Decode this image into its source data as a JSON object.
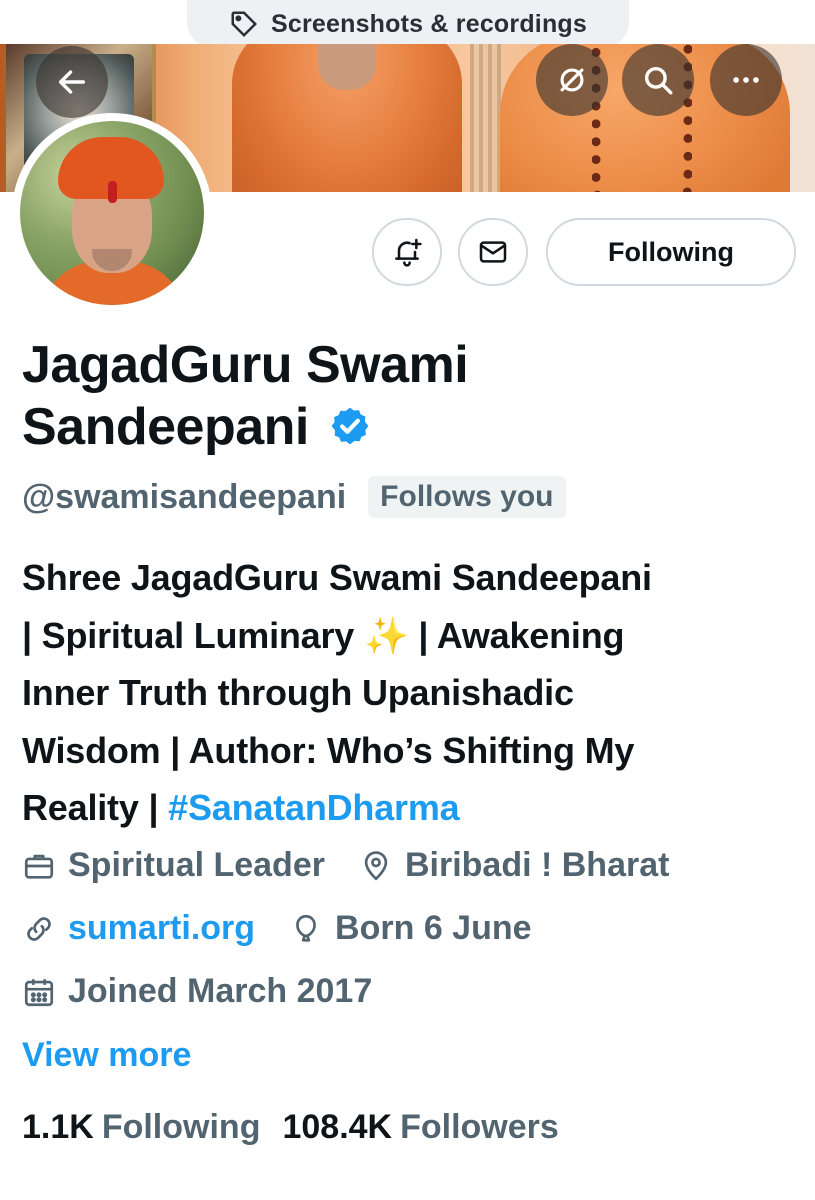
{
  "system": {
    "screenshot_pill": "Screenshots & recordings",
    "icon": "tag-icon"
  },
  "profile": {
    "name_line1": "JagadGuru Swami",
    "name_line2": "Sandeepani",
    "verified": true,
    "handle": "@swamisandeepani",
    "follows_you": "Follows you",
    "bio": {
      "line1": "Shree JagadGuru Swami Sandeepani",
      "line2_a": "| Spiritual Luminary ",
      "line2_emoji": "✨",
      "line2_b": " | Awakening",
      "line3": "Inner Truth through Upanishadic",
      "line4": "Wisdom | Author: Who’s Shifting My",
      "line5_a": "Reality | ",
      "line5_tag": "#SanatanDharma"
    },
    "profession": "Spiritual Leader",
    "location": "Biribadi ! Bharat",
    "website": "sumarti.org",
    "birthday": "Born 6 June",
    "joined": "Joined March 2017",
    "view_more": "View more",
    "following_count": "1.1K",
    "following_label": "Following",
    "followers_count": "108.4K",
    "followers_label": "Followers"
  },
  "actions": {
    "follow_state": "Following",
    "notify_icon": "bell-plus-icon",
    "message_icon": "envelope-icon"
  },
  "colors": {
    "accent": "#1d9bf0",
    "text": "#0f1419",
    "muted": "#536471"
  }
}
